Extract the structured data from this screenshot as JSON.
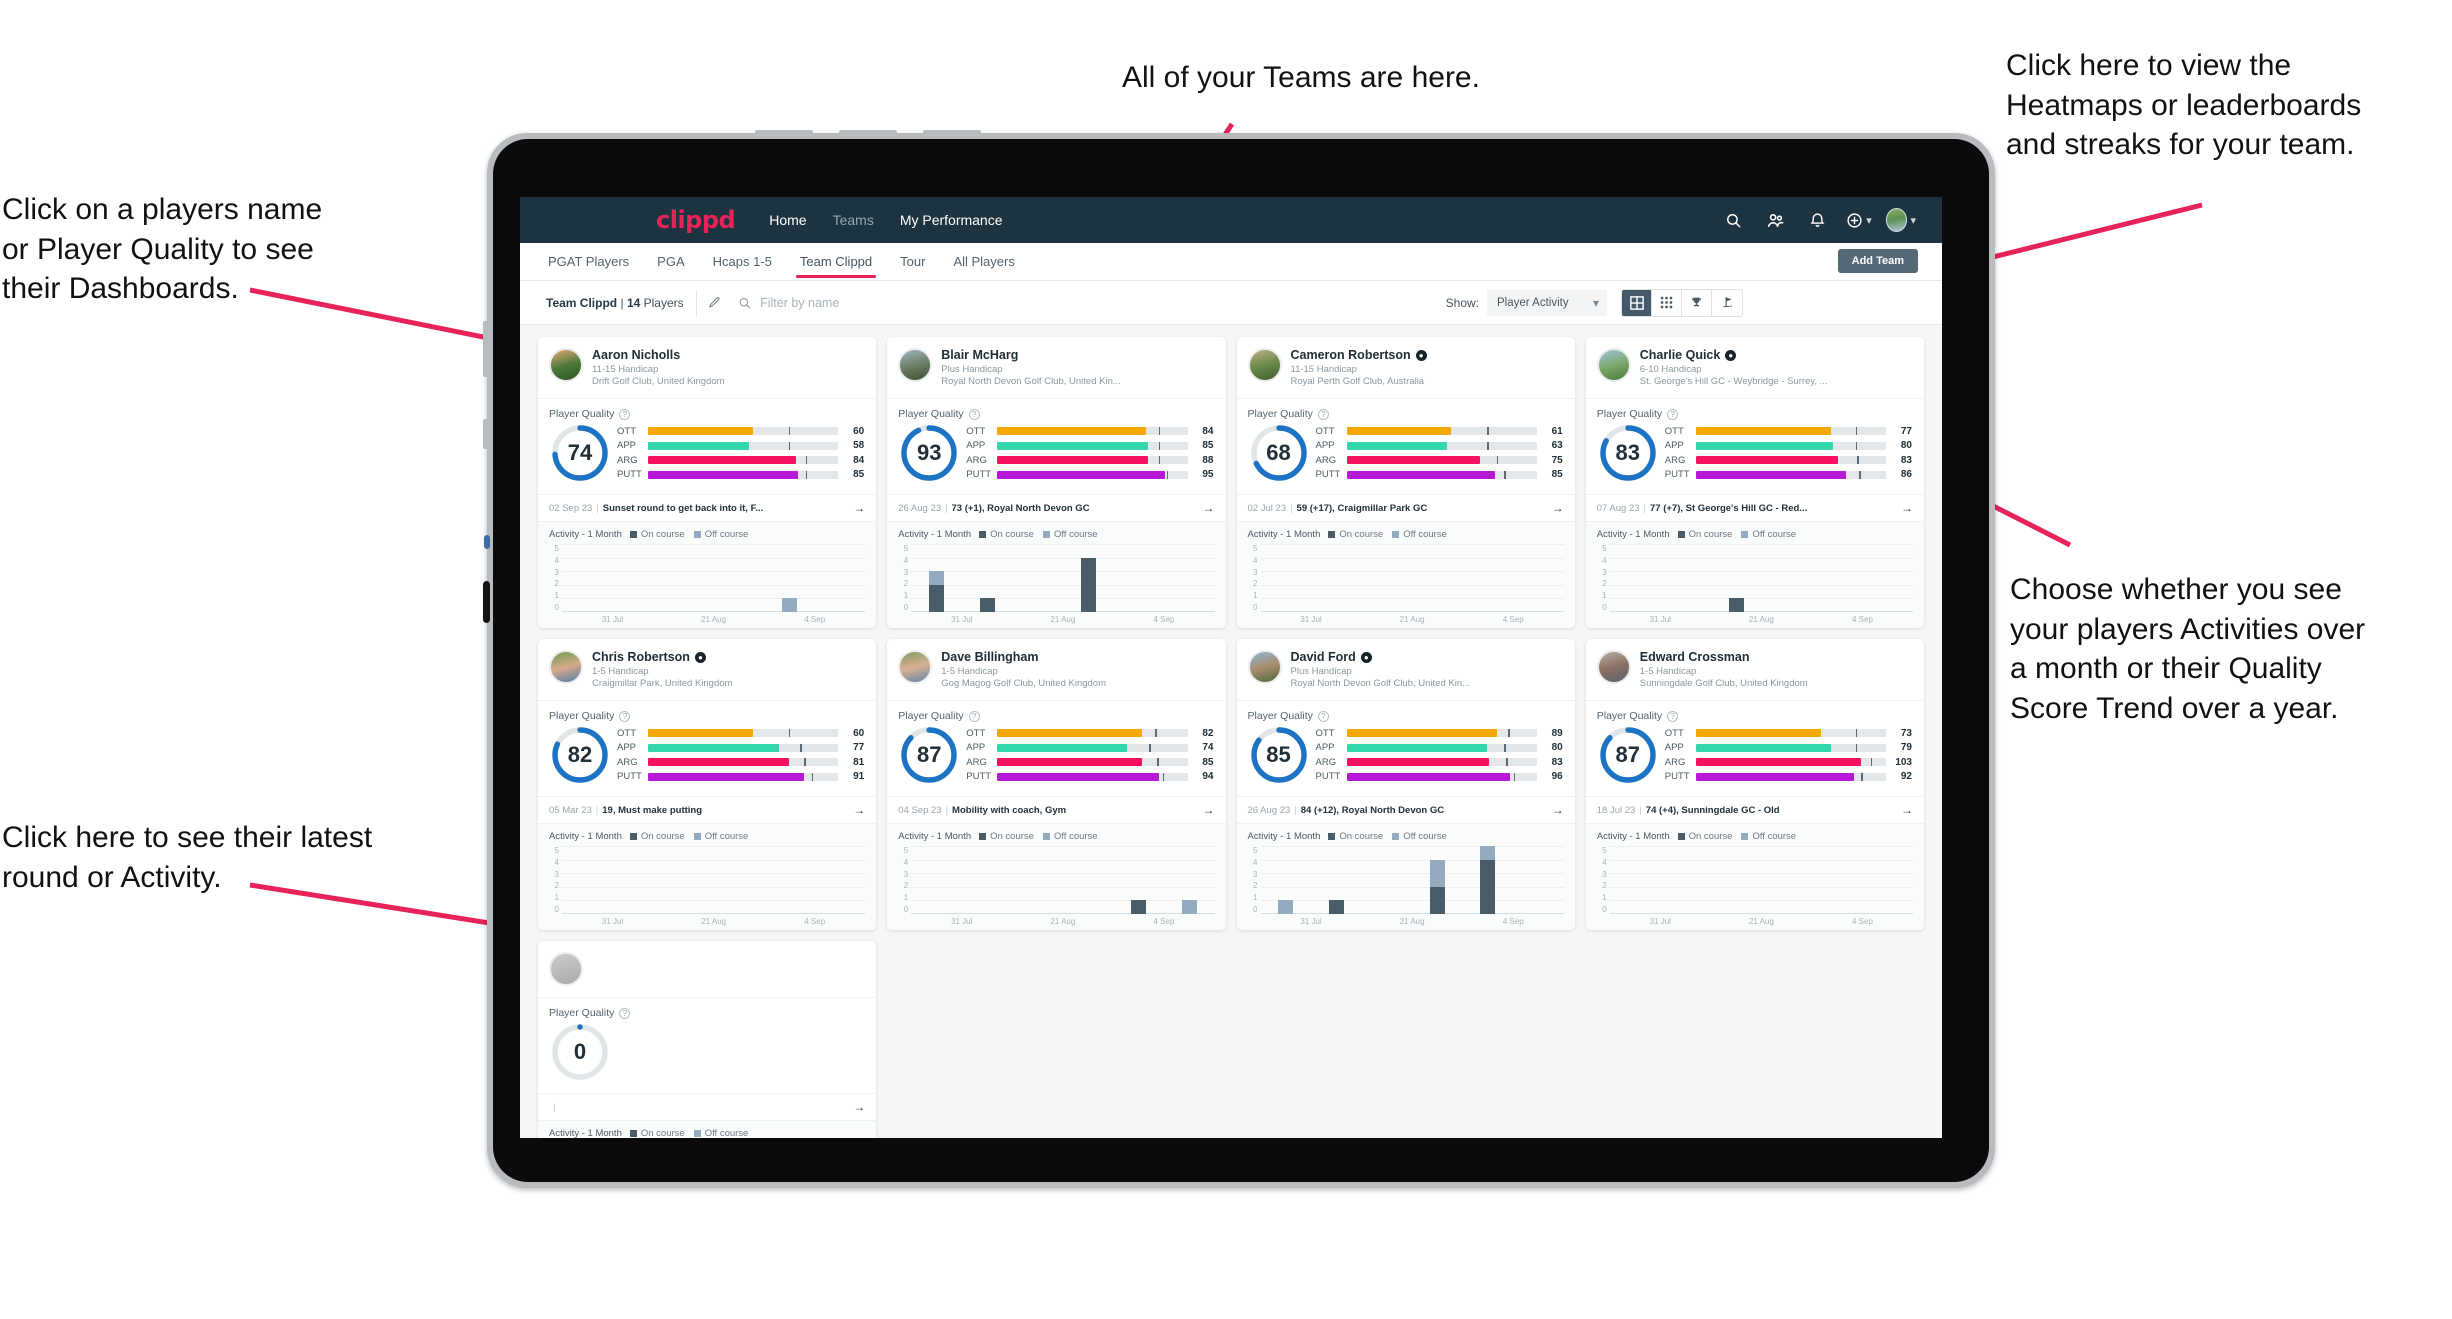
{
  "annotations": {
    "top": "All of your Teams are here.",
    "top_right": "Click here to view the\nHeatmaps or leaderboards\nand streaks for your team.",
    "left_top": "Click on a players name\nor Player Quality to see\ntheir Dashboards.",
    "right_mid": "Choose whether you see\nyour players Activities over\na month or their Quality\nScore Trend over a year.",
    "left_bottom": "Click here to see their latest\nround or Activity.",
    "arrow_color": "#e8235a"
  },
  "app": {
    "brand": "clippd",
    "nav_links": [
      {
        "label": "Home",
        "dim": false
      },
      {
        "label": "Teams",
        "dim": true
      },
      {
        "label": "My Performance",
        "dim": false
      }
    ],
    "nav_icons": [
      {
        "name": "search-icon"
      },
      {
        "name": "people-icon"
      },
      {
        "name": "bell-icon"
      },
      {
        "name": "add-circle-icon"
      },
      {
        "name": "avatar-icon"
      }
    ],
    "subtabs": [
      {
        "label": "PGAT Players",
        "active": false
      },
      {
        "label": "PGA",
        "active": false
      },
      {
        "label": "Hcaps 1-5",
        "active": false
      },
      {
        "label": "Team Clippd",
        "active": true
      },
      {
        "label": "Tour",
        "active": false
      },
      {
        "label": "All Players",
        "active": false
      }
    ],
    "add_team_label": "Add Team",
    "filterbar": {
      "team_name": "Team Clippd",
      "separator": "|",
      "player_count": "14",
      "players_word": "Players",
      "edit_icon": "pencil-icon",
      "search_placeholder": "Filter by name",
      "search_value": "",
      "show_label": "Show:",
      "show_selected": "Player Activity",
      "show_options": [
        "Player Activity",
        "Quality Score Trend"
      ],
      "view_buttons": [
        {
          "name": "grid-large-view",
          "active": true
        },
        {
          "name": "grid-dense-view",
          "active": false
        },
        {
          "name": "leaderboard-trophy-view",
          "active": false
        },
        {
          "name": "heatmap-flag-view",
          "active": false
        }
      ]
    }
  },
  "card_labels": {
    "player_quality": "Player Quality",
    "help": "?",
    "activity_title": "Activity - 1 Month",
    "legend_on": "On course",
    "legend_off": "Off course",
    "arrow": "→",
    "y_ticks": [
      "5",
      "4",
      "3",
      "2",
      "1",
      "0"
    ],
    "x_ticks": [
      "31 Jul",
      "21 Aug",
      "4 Sep"
    ]
  },
  "metric_colors": {
    "OTT": "#f5a800",
    "APP": "#34d6ad",
    "ARG": "#f5115f",
    "PUTT": "#b618d6",
    "ring": "#1c73c4",
    "ring_track": "#e2e5e8"
  },
  "players": [
    {
      "name": "Aaron Nicholls",
      "verified": false,
      "handicap": "11-15 Handicap",
      "club": "Drift Golf Club, United Kingdom",
      "avatar_colors": [
        "#e8a87c",
        "#4e7a3a",
        "#2f5526"
      ],
      "quality": 74,
      "metrics": [
        {
          "label": "OTT",
          "value": 60,
          "fill_pct": 55,
          "tick_pct": 74
        },
        {
          "label": "APP",
          "value": 58,
          "fill_pct": 53,
          "tick_pct": 74
        },
        {
          "label": "ARG",
          "value": 84,
          "fill_pct": 78,
          "tick_pct": 83
        },
        {
          "label": "PUTT",
          "value": 85,
          "fill_pct": 79,
          "tick_pct": 83
        }
      ],
      "latest_date": "02 Sep 23",
      "latest_text": "Sunset round to get back into it, F...",
      "chart": {
        "on": [
          0,
          0,
          0,
          0,
          0,
          0
        ],
        "off": [
          0,
          0,
          0,
          0,
          1,
          0
        ]
      }
    },
    {
      "name": "Blair McHarg",
      "verified": false,
      "handicap": "Plus Handicap",
      "club": "Royal North Devon Golf Club, United Kin...",
      "avatar_colors": [
        "#9fb7c4",
        "#6d7f66",
        "#3e5236"
      ],
      "quality": 93,
      "metrics": [
        {
          "label": "OTT",
          "value": 84,
          "fill_pct": 78,
          "tick_pct": 85
        },
        {
          "label": "APP",
          "value": 85,
          "fill_pct": 79,
          "tick_pct": 85
        },
        {
          "label": "ARG",
          "value": 88,
          "fill_pct": 79,
          "tick_pct": 85
        },
        {
          "label": "PUTT",
          "value": 95,
          "fill_pct": 88,
          "tick_pct": 89
        }
      ],
      "latest_date": "26 Aug 23",
      "latest_text": "73 (+1), Royal North Devon GC",
      "chart": {
        "on": [
          2,
          1,
          0,
          4,
          0,
          0
        ],
        "off": [
          1,
          0,
          0,
          0,
          0,
          0
        ]
      }
    },
    {
      "name": "Cameron Robertson",
      "verified": true,
      "handicap": "11-15 Handicap",
      "club": "Royal Perth Golf Club, Australia",
      "avatar_colors": [
        "#c0b088",
        "#6a8a4a",
        "#3f6030"
      ],
      "quality": 68,
      "metrics": [
        {
          "label": "OTT",
          "value": 61,
          "fill_pct": 55,
          "tick_pct": 74
        },
        {
          "label": "APP",
          "value": 63,
          "fill_pct": 53,
          "tick_pct": 74
        },
        {
          "label": "ARG",
          "value": 75,
          "fill_pct": 70,
          "tick_pct": 79
        },
        {
          "label": "PUTT",
          "value": 85,
          "fill_pct": 78,
          "tick_pct": 83
        }
      ],
      "latest_date": "02 Jul 23",
      "latest_text": "59 (+17), Craigmillar Park GC",
      "chart": {
        "on": [
          0,
          0,
          0,
          0,
          0,
          0
        ],
        "off": [
          0,
          0,
          0,
          0,
          0,
          0
        ]
      }
    },
    {
      "name": "Charlie Quick",
      "verified": true,
      "handicap": "6-10 Handicap",
      "club": "St. George's Hill GC - Weybridge - Surrey, ...",
      "avatar_colors": [
        "#9fc6e0",
        "#7ea86a",
        "#4c7a3c"
      ],
      "quality": 83,
      "metrics": [
        {
          "label": "OTT",
          "value": 77,
          "fill_pct": 71,
          "tick_pct": 84
        },
        {
          "label": "APP",
          "value": 80,
          "fill_pct": 72,
          "tick_pct": 84
        },
        {
          "label": "ARG",
          "value": 83,
          "fill_pct": 75,
          "tick_pct": 85
        },
        {
          "label": "PUTT",
          "value": 86,
          "fill_pct": 79,
          "tick_pct": 86
        }
      ],
      "latest_date": "07 Aug 23",
      "latest_text": "77 (+7), St George's Hill GC - Red...",
      "chart": {
        "on": [
          0,
          0,
          1,
          0,
          0,
          0
        ],
        "off": [
          0,
          0,
          0,
          0,
          0,
          0
        ]
      }
    },
    {
      "name": "Chris Robertson",
      "verified": true,
      "handicap": "1-5 Handicap",
      "club": "Craigmillar Park, United Kingdom",
      "avatar_colors": [
        "#6f9c55",
        "#d7a98a",
        "#4f7fa8"
      ],
      "quality": 82,
      "metrics": [
        {
          "label": "OTT",
          "value": 60,
          "fill_pct": 55,
          "tick_pct": 74
        },
        {
          "label": "APP",
          "value": 77,
          "fill_pct": 69,
          "tick_pct": 80
        },
        {
          "label": "ARG",
          "value": 81,
          "fill_pct": 74,
          "tick_pct": 82
        },
        {
          "label": "PUTT",
          "value": 91,
          "fill_pct": 82,
          "tick_pct": 86
        }
      ],
      "latest_date": "05 Mar 23",
      "latest_text": "19, Must make putting",
      "chart": {
        "on": [
          0,
          0,
          0,
          0,
          0,
          0
        ],
        "off": [
          0,
          0,
          0,
          0,
          0,
          0
        ]
      }
    },
    {
      "name": "Dave Billingham",
      "verified": false,
      "handicap": "1-5 Handicap",
      "club": "Gog Magog Golf Club, United Kingdom",
      "avatar_colors": [
        "#7f9b5e",
        "#d8b095",
        "#5f87a8"
      ],
      "quality": 87,
      "metrics": [
        {
          "label": "OTT",
          "value": 82,
          "fill_pct": 76,
          "tick_pct": 83
        },
        {
          "label": "APP",
          "value": 74,
          "fill_pct": 68,
          "tick_pct": 80
        },
        {
          "label": "ARG",
          "value": 85,
          "fill_pct": 76,
          "tick_pct": 84
        },
        {
          "label": "PUTT",
          "value": 94,
          "fill_pct": 85,
          "tick_pct": 87
        }
      ],
      "latest_date": "04 Sep 23",
      "latest_text": "Mobility with coach, Gym",
      "chart": {
        "on": [
          0,
          0,
          0,
          0,
          1,
          0
        ],
        "off": [
          0,
          0,
          0,
          0,
          0,
          1
        ]
      }
    },
    {
      "name": "David Ford",
      "verified": true,
      "handicap": "Plus Handicap",
      "club": "Royal North Devon Golf Club, United Kin...",
      "avatar_colors": [
        "#8fb8d4",
        "#a78d6c",
        "#4a6b3a"
      ],
      "quality": 85,
      "metrics": [
        {
          "label": "OTT",
          "value": 89,
          "fill_pct": 79,
          "tick_pct": 85
        },
        {
          "label": "APP",
          "value": 80,
          "fill_pct": 74,
          "tick_pct": 83
        },
        {
          "label": "ARG",
          "value": 83,
          "fill_pct": 75,
          "tick_pct": 84
        },
        {
          "label": "PUTT",
          "value": 96,
          "fill_pct": 86,
          "tick_pct": 88
        }
      ],
      "latest_date": "26 Aug 23",
      "latest_text": "84 (+12), Royal North Devon GC",
      "chart": {
        "on": [
          0,
          1,
          0,
          2,
          4,
          0
        ],
        "off": [
          1,
          0,
          0,
          2,
          1,
          0
        ]
      }
    },
    {
      "name": "Edward Crossman",
      "verified": false,
      "handicap": "1-5 Handicap",
      "club": "Sunningdale Golf Club, United Kingdom",
      "avatar_colors": [
        "#b9b2a6",
        "#8a6f63",
        "#5d6470"
      ],
      "quality": 87,
      "metrics": [
        {
          "label": "OTT",
          "value": 73,
          "fill_pct": 66,
          "tick_pct": 84
        },
        {
          "label": "APP",
          "value": 79,
          "fill_pct": 71,
          "tick_pct": 84
        },
        {
          "label": "ARG",
          "value": 103,
          "fill_pct": 87,
          "tick_pct": 92
        },
        {
          "label": "PUTT",
          "value": 92,
          "fill_pct": 83,
          "tick_pct": 87
        }
      ],
      "latest_date": "18 Jul 23",
      "latest_text": "74 (+4), Sunningdale GC - Old",
      "chart": {
        "on": [
          0,
          0,
          0,
          0,
          0,
          0
        ],
        "off": [
          0,
          0,
          0,
          0,
          0,
          0
        ]
      }
    },
    {
      "name": "",
      "verified": false,
      "handicap": "",
      "club": "",
      "avatar_colors": [
        "#cccccc",
        "#bbbbbb",
        "#aaaaaa"
      ],
      "quality": 0,
      "metrics": [],
      "latest_date": "",
      "latest_text": "",
      "chart": {
        "on": [
          0,
          0,
          0,
          0,
          0,
          0
        ],
        "off": [
          0,
          0,
          0,
          0,
          0,
          0
        ]
      }
    }
  ]
}
